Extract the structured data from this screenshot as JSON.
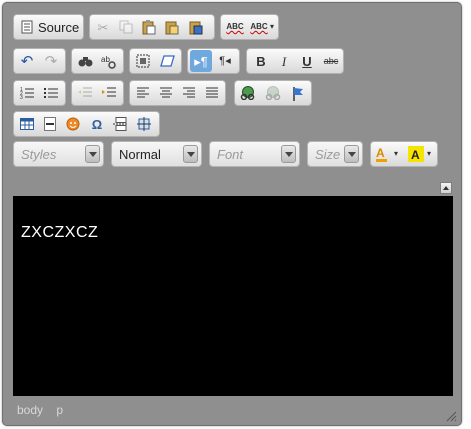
{
  "toolbar": {
    "source_label": "Source",
    "styles_placeholder": "Styles",
    "format_value": "Normal",
    "font_placeholder": "Font",
    "size_placeholder": "Size",
    "bold_label": "B",
    "italic_label": "I",
    "underline_label": "U",
    "strike_label": "abc",
    "spell_label": "ABC",
    "scayt_label": "ABC"
  },
  "content": {
    "text": "ZXCZXCZ",
    "background": "#000000",
    "text_color": "#ffffff"
  },
  "elements_path": [
    "body",
    "p"
  ]
}
